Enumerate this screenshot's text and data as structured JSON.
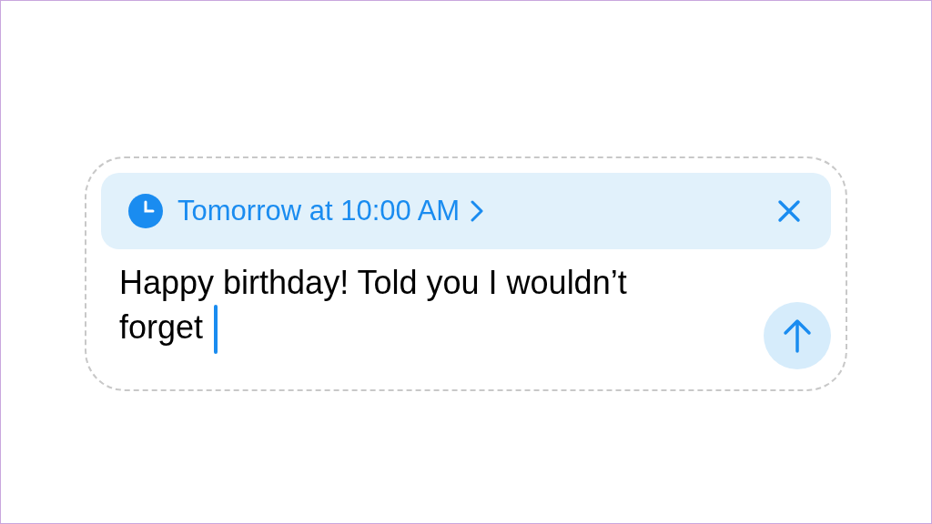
{
  "schedule": {
    "label": "Tomorrow at 10:00 AM"
  },
  "message": {
    "value": "Happy birthday! Told you I wouldn’t forget"
  }
}
